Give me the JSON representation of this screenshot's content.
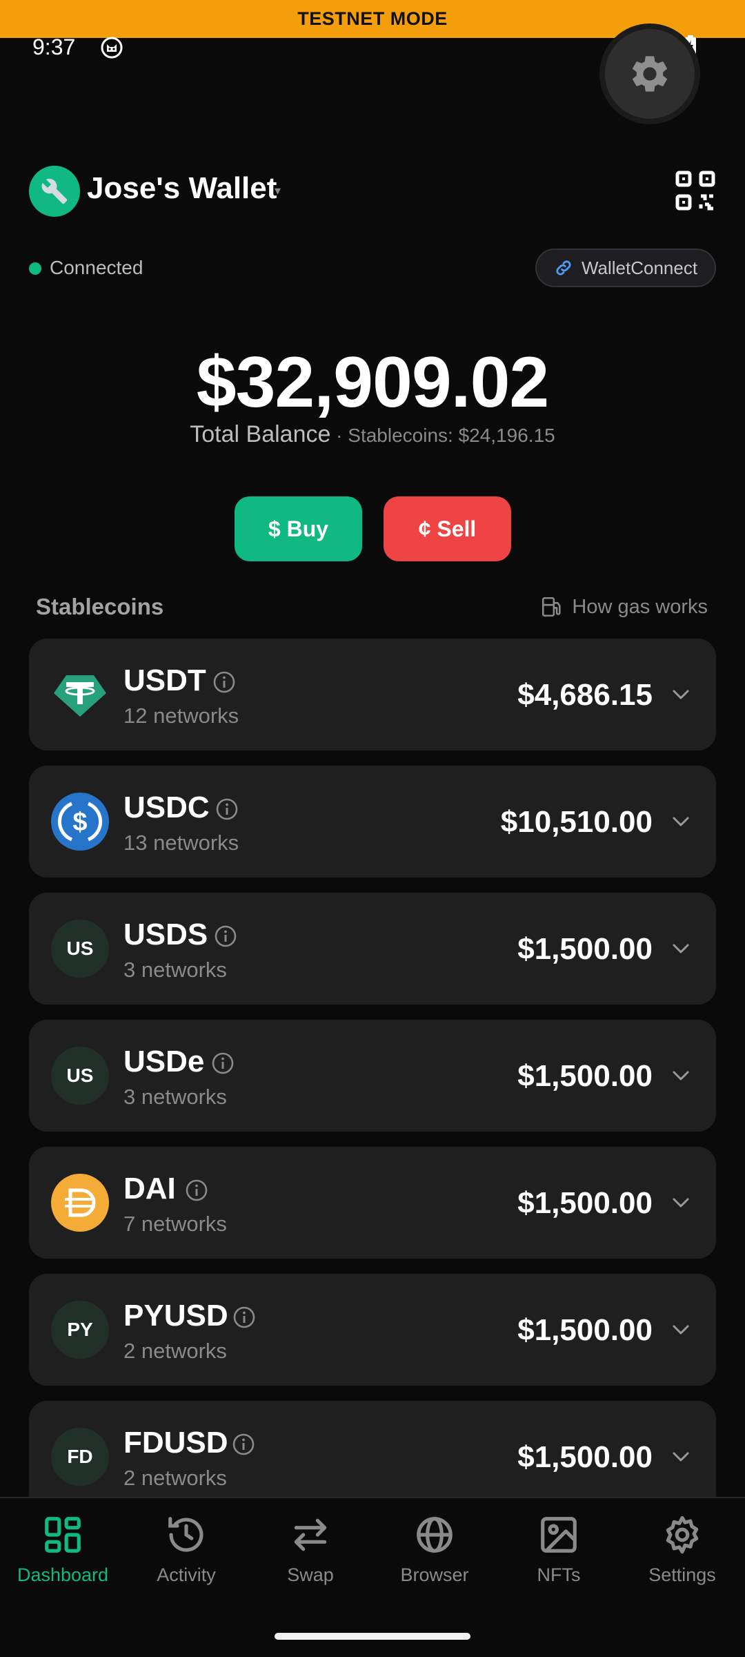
{
  "banner": {
    "text": "TESTNET MODE"
  },
  "status_bar": {
    "time": "9:37"
  },
  "wallet": {
    "name": "Jose's Wallet",
    "caret": "▾",
    "avatar_icon": "wrench-icon"
  },
  "connection": {
    "status": "Connected",
    "walletconnect_label": "WalletConnect"
  },
  "balance": {
    "amount": "$32,909.02",
    "label": "Total Balance",
    "stablecoins_text": " · Stablecoins: $24,196.15"
  },
  "actions": {
    "buy_label": "$ Buy",
    "sell_label": "¢ Sell"
  },
  "stablecoins": {
    "title": "Stablecoins",
    "gas_link": "How gas works",
    "items": [
      {
        "symbol": "USDT",
        "networks": "12 networks",
        "value": "$4,686.15",
        "icon": "tether-icon",
        "color": "#26a17b"
      },
      {
        "symbol": "USDC",
        "networks": "13 networks",
        "value": "$10,510.00",
        "icon": "usdc-icon",
        "color": "#2775ca"
      },
      {
        "symbol": "USDS",
        "networks": "3 networks",
        "value": "$1,500.00",
        "icon_text": "US"
      },
      {
        "symbol": "USDe",
        "networks": "3 networks",
        "value": "$1,500.00",
        "icon_text": "US"
      },
      {
        "symbol": "DAI",
        "networks": "7 networks",
        "value": "$1,500.00",
        "icon": "dai-icon",
        "color": "#f5ac37"
      },
      {
        "symbol": "PYUSD",
        "networks": "2 networks",
        "value": "$1,500.00",
        "icon_text": "PY"
      },
      {
        "symbol": "FDUSD",
        "networks": "2 networks",
        "value": "$1,500.00",
        "icon_text": "FD"
      }
    ]
  },
  "tabs": [
    {
      "label": "Dashboard",
      "icon": "dashboard-icon",
      "active": true
    },
    {
      "label": "Activity",
      "icon": "history-icon"
    },
    {
      "label": "Swap",
      "icon": "swap-icon"
    },
    {
      "label": "Browser",
      "icon": "globe-icon"
    },
    {
      "label": "NFTs",
      "icon": "image-icon"
    },
    {
      "label": "Settings",
      "icon": "gear-icon"
    }
  ],
  "colors": {
    "accent": "#10b981",
    "danger": "#ef4444",
    "banner": "#f59e0b",
    "card": "#1f1f1f",
    "background": "#0a0a0a"
  }
}
